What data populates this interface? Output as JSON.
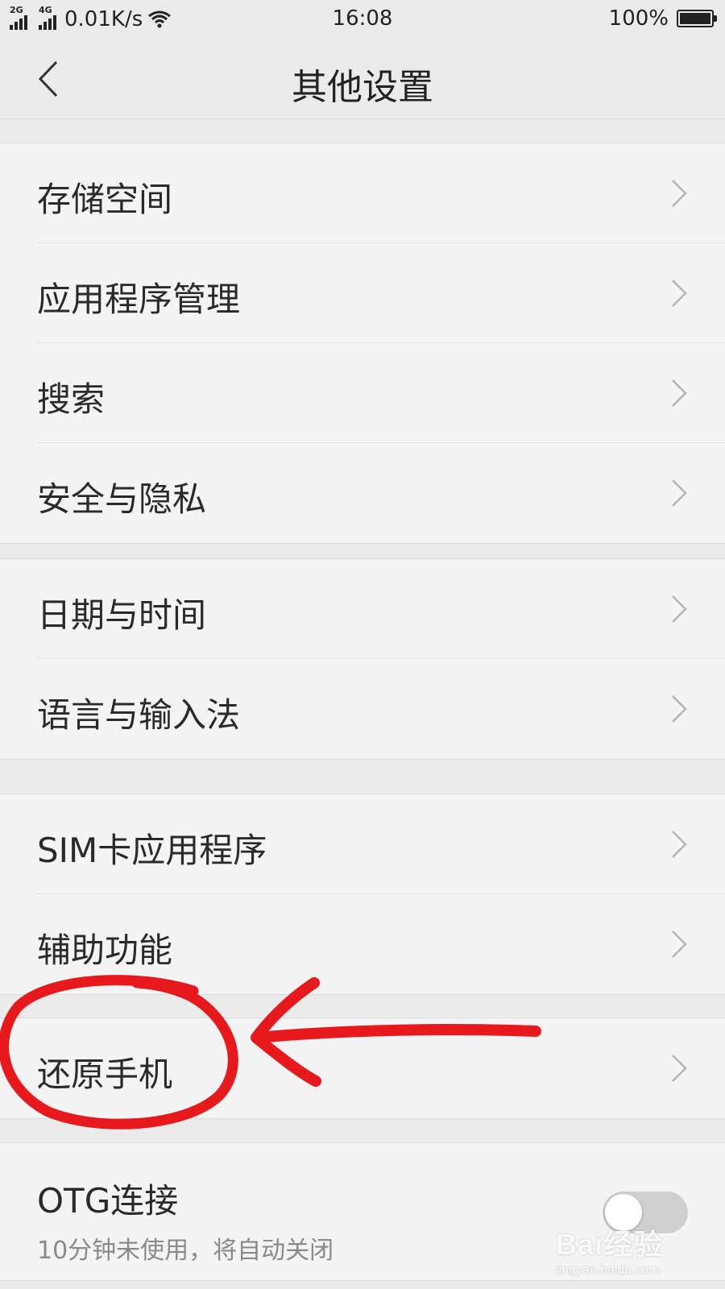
{
  "status_bar": {
    "sim1_type": "2G",
    "sim2_type": "4G",
    "net_speed": "0.01K/s",
    "time": "16:08",
    "battery": "100%",
    "wifi_icon": "wifi-icon",
    "battery_level": 1.0
  },
  "header": {
    "title": "其他设置",
    "back_icon": "chevron-left-icon"
  },
  "groups": [
    {
      "items": [
        {
          "label": "存储空间"
        },
        {
          "label": "应用程序管理"
        },
        {
          "label": "搜索"
        },
        {
          "label": "安全与隐私"
        }
      ]
    },
    {
      "items": [
        {
          "label": "日期与时间"
        },
        {
          "label": "语言与输入法"
        }
      ]
    },
    {
      "items": [
        {
          "label": "SIM卡应用程序"
        },
        {
          "label": "辅助功能"
        }
      ]
    },
    {
      "items": [
        {
          "label": "还原手机"
        }
      ]
    },
    {
      "items": [
        {
          "label": "OTG连接",
          "subtitle": "10分钟未使用，将自动关闭",
          "toggle": false
        }
      ]
    }
  ],
  "annotation": {
    "color": "#e8191d",
    "highlighted_item": "还原手机"
  },
  "watermark": {
    "text": "Bai经验",
    "url": "jingyan.baidu.com"
  },
  "colors": {
    "background": "#ebebeb",
    "row_background": "#f4f4f4",
    "toggle_off": "#cfcfcf"
  }
}
